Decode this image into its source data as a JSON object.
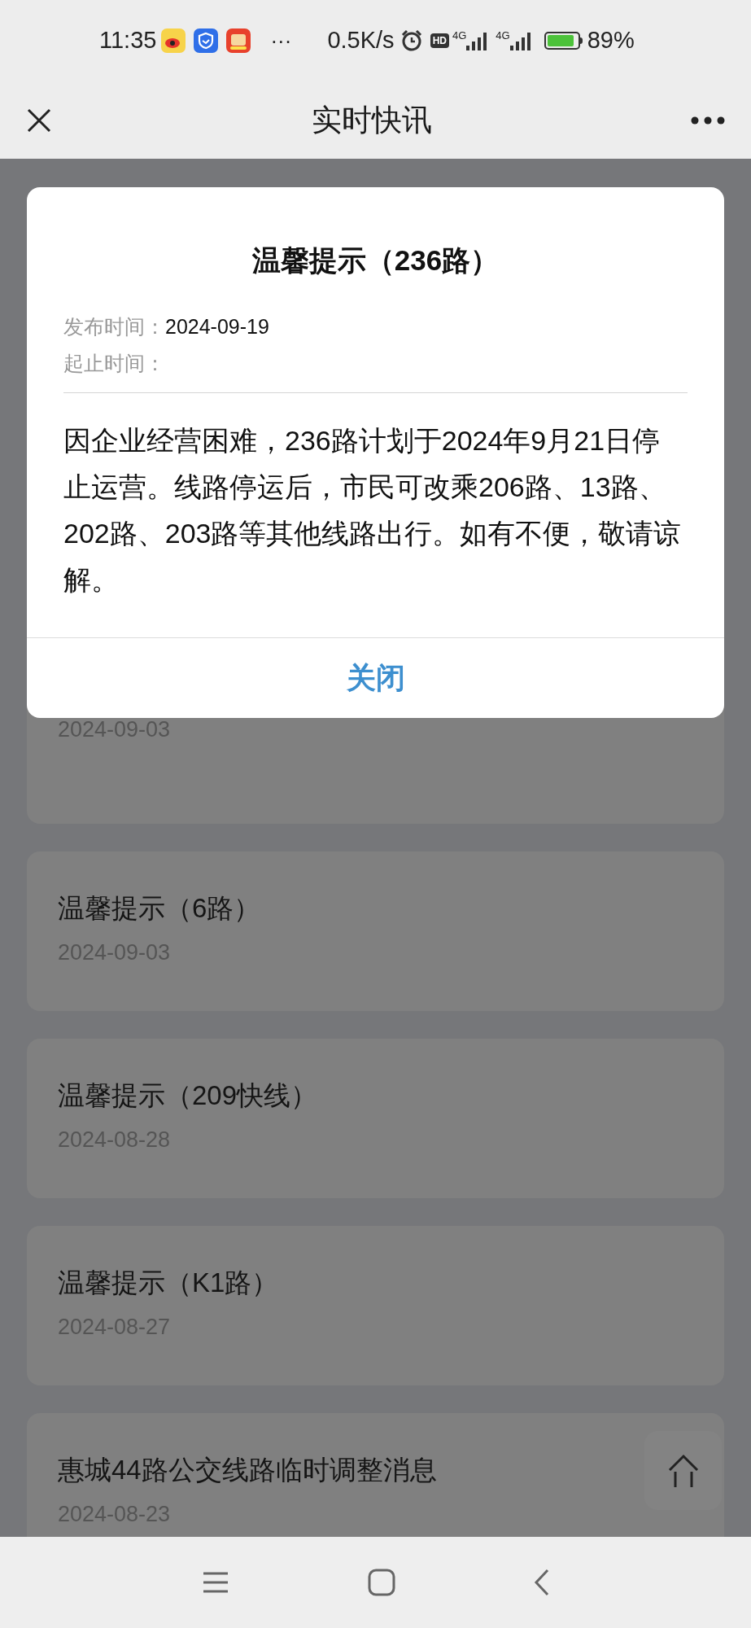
{
  "status_bar": {
    "time": "11:35",
    "more": "···",
    "network_speed": "0.5K/s",
    "hd": "HD",
    "sim_1": "4G",
    "sim_2": "4G",
    "battery": "89%"
  },
  "header": {
    "title": "实时快讯"
  },
  "notices": [
    {
      "date": "2024-09-03"
    },
    {
      "title": "温馨提示（6路）",
      "date": "2024-09-03"
    },
    {
      "title": "温馨提示（209快线）",
      "date": "2024-08-28"
    },
    {
      "title": "温馨提示（K1路）",
      "date": "2024-08-27"
    },
    {
      "title": "惠城44路公交线路临时调整消息",
      "date": "2024-08-23"
    }
  ],
  "dialog": {
    "title": "温馨提示（236路）",
    "publish_label": "发布时间：",
    "publish_date": "2024-09-19",
    "period_label": "起止时间：",
    "body": "因企业经营困难，236路计划于2024年9月21日停止运营。线路停运后，市民可改乘206路、13路、202路、203路等其他线路出行。如有不便，敬请谅解。",
    "close_button": "关闭"
  }
}
